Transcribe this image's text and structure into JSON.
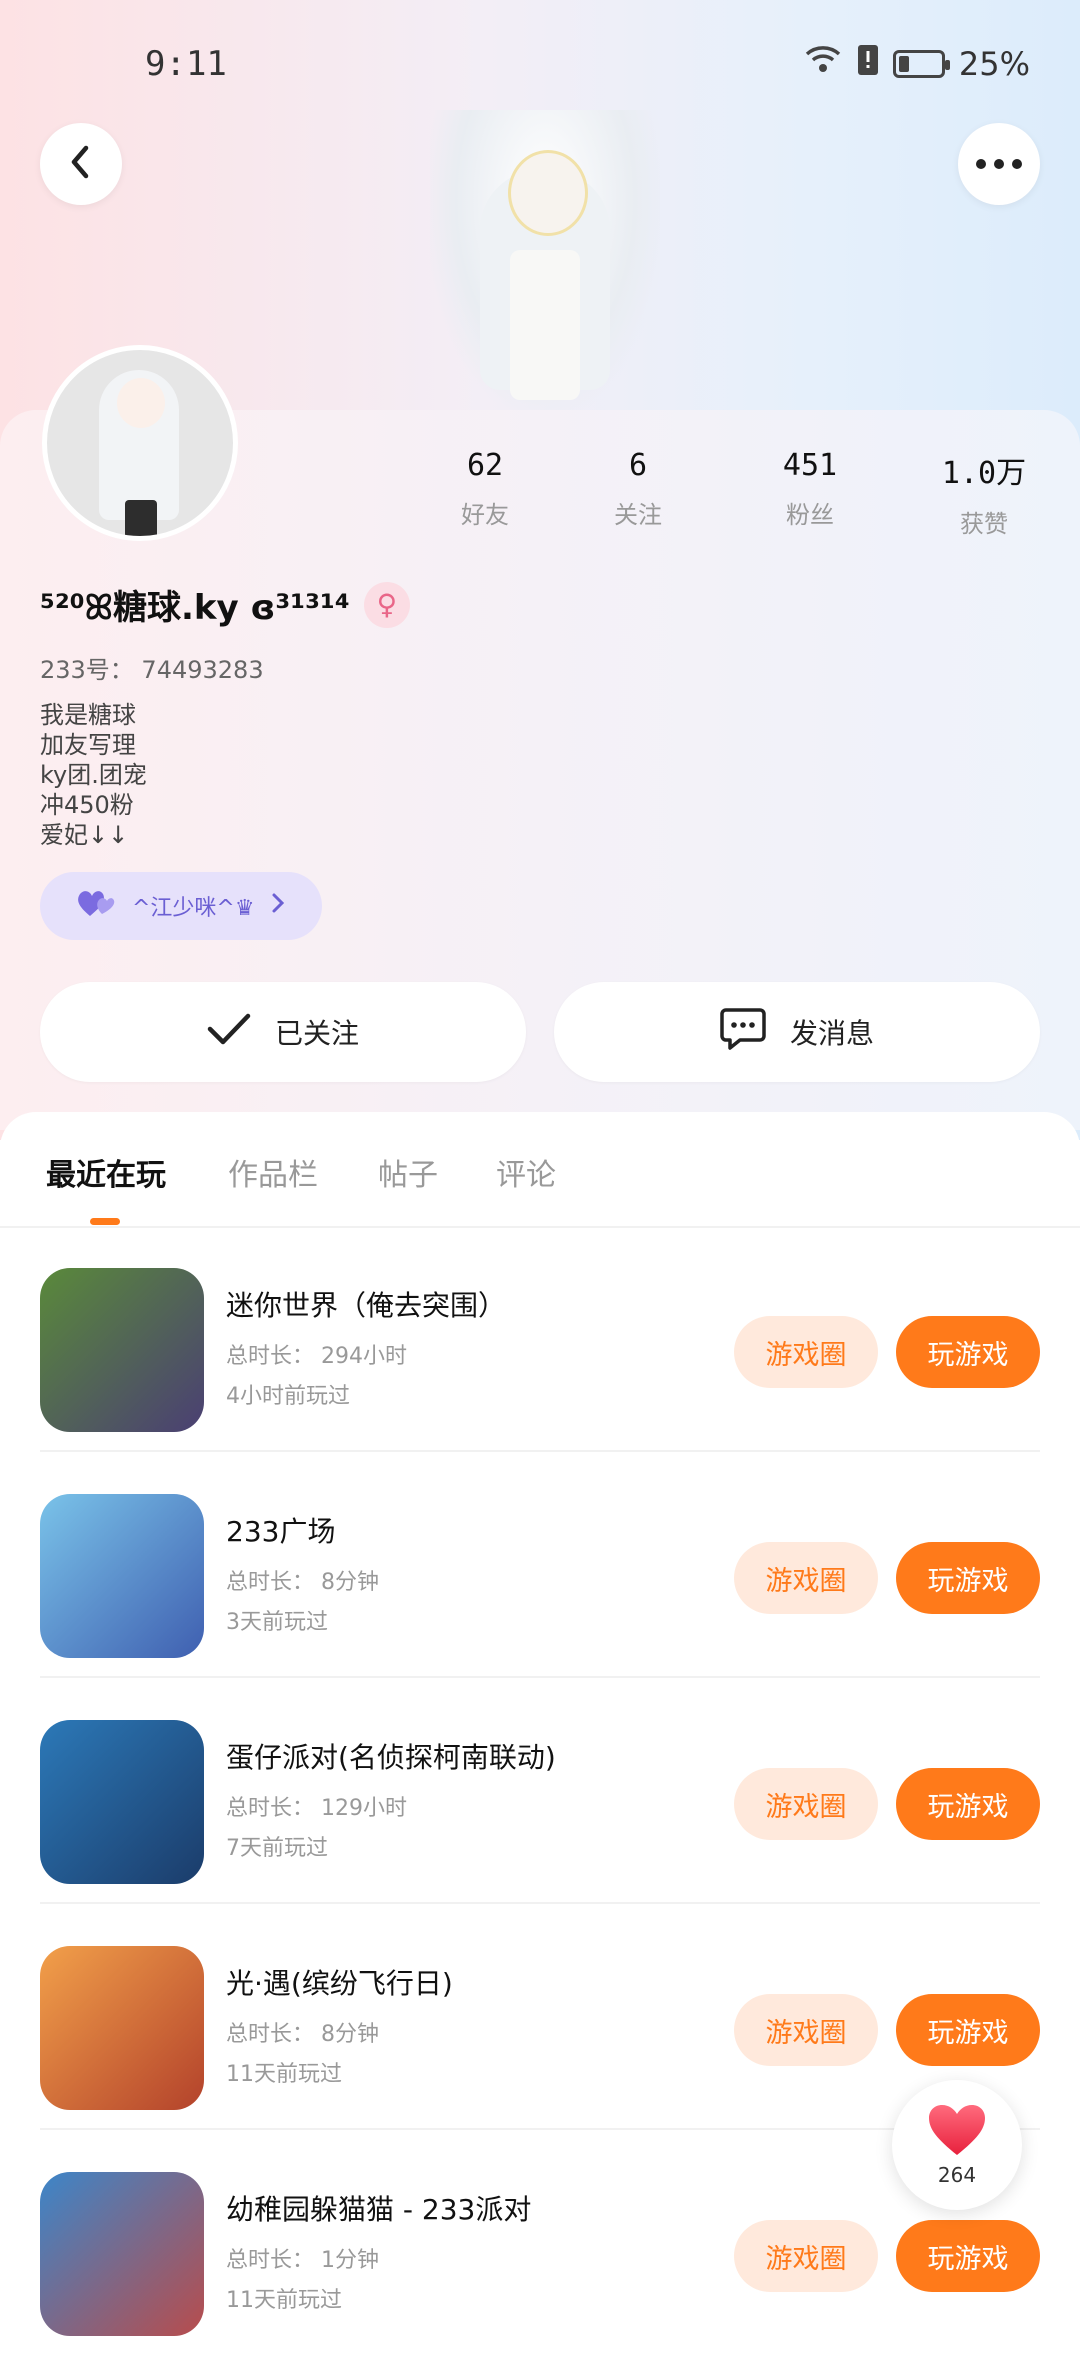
{
  "status_bar": {
    "time": "9:11",
    "battery": "25%",
    "battery_level": 0.25
  },
  "profile": {
    "name": "⁵²⁰ꕤ糖球.ky ɞ³¹³¹⁴",
    "uid": "233号： 74493283",
    "bio": [
      "我是糖球",
      "加友写理",
      "ky团.团宠",
      "冲450粉",
      "爱妃↓↓"
    ],
    "club": "^江少咪^♛",
    "stats": [
      {
        "value": "62",
        "label": "好友"
      },
      {
        "value": "6",
        "label": "关注"
      },
      {
        "value": "451",
        "label": "粉丝"
      },
      {
        "value": "1.0万",
        "label": "获赞"
      }
    ]
  },
  "actions": {
    "followed": "已关注",
    "message": "发消息"
  },
  "tabs": [
    "最近在玩",
    "作品栏",
    "帖子",
    "评论"
  ],
  "game_buttons": {
    "circle": "游戏圈",
    "play": "玩游戏"
  },
  "games": [
    {
      "title": "迷你世界（俺去突围）",
      "duration": "总时长： 294小时",
      "ago": "4小时前玩过",
      "colors": [
        "#5a8a3a",
        "#4a3f73"
      ]
    },
    {
      "title": "233广场",
      "duration": "总时长： 8分钟",
      "ago": "3天前玩过",
      "colors": [
        "#7ac3e9",
        "#3f5fb0"
      ]
    },
    {
      "title": "蛋仔派对(名侦探柯南联动)",
      "duration": "总时长： 129小时",
      "ago": "7天前玩过",
      "colors": [
        "#2c79b8",
        "#1b3c6a"
      ]
    },
    {
      "title": "光·遇(缤纷飞行日)",
      "duration": "总时长： 8分钟",
      "ago": "11天前玩过",
      "colors": [
        "#f2a04a",
        "#b3422b"
      ]
    },
    {
      "title": "幼稚园躲猫猫 - 233派对",
      "duration": "总时长： 1分钟",
      "ago": "11天前玩过",
      "colors": [
        "#3c86c9",
        "#b84c4c"
      ]
    }
  ],
  "like_float": {
    "count": "264"
  }
}
